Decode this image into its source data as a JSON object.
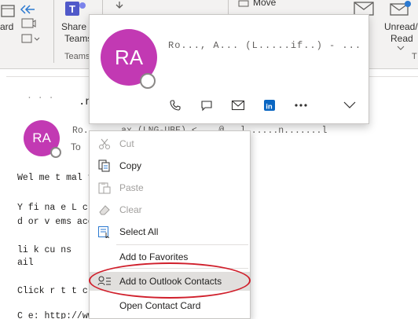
{
  "ribbon": {
    "card_label": "ard",
    "share_label_1": "Share t",
    "share_label_2": "Teams",
    "teams_group": "Teams",
    "move_label": "Move",
    "unread_label_1": "Unread/",
    "unread_label_2": "Read",
    "group_t": "T"
  },
  "card": {
    "initials": "RA",
    "name_obscured": "Ro..., A... (L.....if..) - ...",
    "action_icons": [
      "phone-icon",
      "chat-icon",
      "mail-icon",
      "linkedin-icon",
      "more-icon",
      "expand-icon"
    ]
  },
  "message": {
    "initials": "RA",
    "header_fragment": ".n",
    "sender_obscured": "Ro...  ...ax (LNG-UBE) <        ...@...l......n.......l",
    "to_label": "To",
    "body": [
      "Wel  me   t                              mal f      roduct Revi w",
      "Y    fi   na                    e L    c              ro.    as",
      "  d  or                    v            ems acco    gi.",
      "       li  k                          cu                    ns",
      "ail",
      "Click   r                              t  t   c oud     ntire cat",
      "C    e: http://www.dropbox.com/..."
    ]
  },
  "context_menu": {
    "items": [
      {
        "label": "Cut",
        "icon": "scissors-icon",
        "enabled": false
      },
      {
        "label": "Copy",
        "icon": "copy-icon",
        "enabled": true
      },
      {
        "label": "Paste",
        "icon": "paste-icon",
        "enabled": false
      },
      {
        "label": "Clear",
        "icon": "eraser-icon",
        "enabled": false
      },
      {
        "label": "Select All",
        "icon": "select-all-icon",
        "enabled": true
      },
      {
        "label": "Add to Favorites",
        "icon": "",
        "enabled": true
      },
      {
        "label": "Add to Outlook Contacts",
        "icon": "add-contact-icon",
        "enabled": true,
        "highlighted": true
      },
      {
        "label": "Open Contact Card",
        "icon": "",
        "enabled": true
      }
    ]
  },
  "colors": {
    "avatar": "#c239b3",
    "highlight": "#e1dfdd",
    "annotation_ellipse": "#d01f2b",
    "linkedin": "#0a66c2",
    "link": "#0563c1"
  }
}
